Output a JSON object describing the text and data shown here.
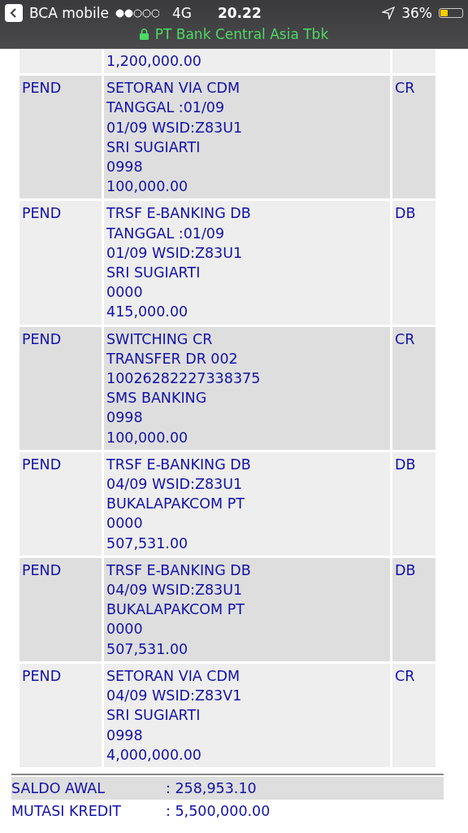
{
  "status_bar": {
    "back_label": "BCA mobile",
    "network": "4G",
    "time": "20.22",
    "battery_text": "36%",
    "battery": {
      "level": 0.36
    },
    "site": "PT Bank Central Asia Tbk"
  },
  "transactions": [
    {
      "lines": [
        "1,200,000.00"
      ]
    },
    {
      "status": "PEND",
      "lines": [
        "SETORAN VIA CDM",
        "TANGGAL :01/09",
        "01/09 WSID:Z83U1",
        "SRI SUGIARTI",
        "0998",
        "100,000.00"
      ],
      "type": "CR"
    },
    {
      "status": "PEND",
      "lines": [
        "TRSF E-BANKING DB",
        "TANGGAL :01/09",
        "01/09 WSID:Z83U1",
        "SRI SUGIARTI",
        "0000",
        "415,000.00"
      ],
      "type": "DB"
    },
    {
      "status": "PEND",
      "lines": [
        "SWITCHING CR",
        "TRANSFER DR 002",
        "10026282227338375",
        "SMS BANKING",
        "0998",
        "100,000.00"
      ],
      "type": "CR"
    },
    {
      "status": "PEND",
      "lines": [
        "TRSF E-BANKING DB",
        "04/09 WSID:Z83U1",
        "BUKALAPAKCOM PT",
        "0000",
        "507,531.00"
      ],
      "type": "DB"
    },
    {
      "status": "PEND",
      "lines": [
        "TRSF E-BANKING DB",
        "04/09 WSID:Z83U1",
        "BUKALAPAKCOM PT",
        "0000",
        "507,531.00"
      ],
      "type": "DB"
    },
    {
      "status": "PEND",
      "lines": [
        "SETORAN VIA CDM",
        "04/09 WSID:Z83V1",
        "SRI SUGIARTI",
        "0998",
        "4,000,000.00"
      ],
      "type": "CR"
    }
  ],
  "summary": [
    {
      "label": "SALDO AWAL",
      "value": ": 258,953.10"
    },
    {
      "label": "MUTASI KREDIT",
      "value": ": 5,500,000.00"
    }
  ]
}
